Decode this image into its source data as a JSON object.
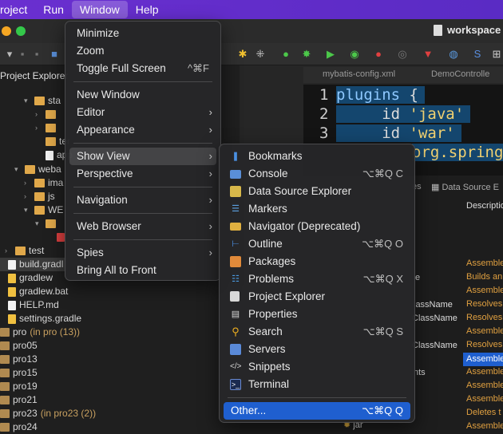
{
  "menubar": {
    "items": [
      "roject",
      "Run",
      "Window",
      "Help"
    ]
  },
  "window": {
    "title": "workspace"
  },
  "explorer": {
    "title": "Project Explorer",
    "rows": [
      "sta",
      "ter",
      "app",
      "weba",
      "ima",
      "js",
      "WE",
      "test",
      "build.gradl",
      "gradlew",
      "gradlew.bat",
      "HELP.md",
      "settings.gradle",
      "pro",
      "pro05",
      "pro13",
      "pro15",
      "pro19",
      "pro21",
      "pro23",
      "pro24"
    ],
    "pro_suffix": "(in pro (13))",
    "pro23_suffix": "(in pro23 (2))"
  },
  "editor": {
    "tabs": [
      "mybatis-config.xml",
      "DemoControlle"
    ],
    "line_numbers": [
      "1",
      "2",
      "3"
    ],
    "lines": [
      {
        "a": "plugins ",
        "b": "{"
      },
      {
        "a": "     id ",
        "b": "'java'"
      },
      {
        "a": "     id ",
        "b": "'war'"
      },
      {
        "a": "",
        "b": "org.spring"
      }
    ]
  },
  "view": {
    "headers": [
      "es",
      "Data Source E",
      "Descriptio"
    ],
    "left_texts": [
      "e",
      "lassName",
      "ClassName",
      "ClassName",
      "nts"
    ],
    "desc_rows": [
      "Assemble",
      "Builds an",
      "Assemble",
      "Resolves",
      "Resolves",
      "Assemble",
      "Resolves",
      "Assemble",
      "Assemble",
      "Assemble",
      "Assemble",
      "Deletes t",
      "Assemble"
    ],
    "last_item": "jar"
  },
  "window_menu": {
    "items": [
      {
        "label": "Minimize"
      },
      {
        "label": "Zoom"
      },
      {
        "label": "Toggle Full Screen",
        "shortcut": "^⌘F"
      },
      {
        "label": "New Window"
      },
      {
        "label": "Editor",
        "chevron": "›"
      },
      {
        "label": "Appearance",
        "chevron": "›"
      },
      {
        "label": "Show View",
        "chevron": "›"
      },
      {
        "label": "Perspective",
        "chevron": "›"
      },
      {
        "label": "Navigation",
        "chevron": "›"
      },
      {
        "label": "Web Browser",
        "chevron": "›"
      },
      {
        "label": "Spies",
        "chevron": "›"
      },
      {
        "label": "Bring All to Front"
      }
    ]
  },
  "show_view_menu": {
    "items": [
      {
        "label": "Bookmarks",
        "shortcut": "",
        "icon": "bookmark-icon",
        "color": "#4a90e2"
      },
      {
        "label": "Console",
        "shortcut": "⌥⌘Q C",
        "icon": "console-icon",
        "color": "#5a8fd8"
      },
      {
        "label": "Data Source Explorer",
        "shortcut": "",
        "icon": "data-source-icon",
        "color": "#d8b84a"
      },
      {
        "label": "Markers",
        "shortcut": "",
        "icon": "markers-icon",
        "color": "#5aa0e0"
      },
      {
        "label": "Navigator (Deprecated)",
        "shortcut": "",
        "icon": "navigator-icon",
        "color": "#e0b040"
      },
      {
        "label": "Outline",
        "shortcut": "⌥⌘Q O",
        "icon": "outline-icon",
        "color": "#4a8ee0"
      },
      {
        "label": "Packages",
        "shortcut": "",
        "icon": "packages-icon",
        "color": "#e08a3a"
      },
      {
        "label": "Problems",
        "shortcut": "⌥⌘Q X",
        "icon": "problems-icon",
        "color": "#4a9ae0"
      },
      {
        "label": "Project Explorer",
        "shortcut": "",
        "icon": "project-explorer-icon",
        "color": "#d8d8d8"
      },
      {
        "label": "Properties",
        "shortcut": "",
        "icon": "properties-icon",
        "color": "#d8d8d8"
      },
      {
        "label": "Search",
        "shortcut": "⌥⌘Q S",
        "icon": "search-icon",
        "color": "#f0b020"
      },
      {
        "label": "Servers",
        "shortcut": "",
        "icon": "servers-icon",
        "color": "#5a8ad8"
      },
      {
        "label": "Snippets",
        "shortcut": "",
        "icon": "snippets-icon",
        "color": "#d8d8d8"
      },
      {
        "label": "Terminal",
        "shortcut": "",
        "icon": "terminal-icon",
        "color": "#3a5aa0"
      },
      {
        "label": "Other...",
        "shortcut": "⌥⌘Q Q",
        "icon": "",
        "color": ""
      }
    ]
  },
  "colors": {
    "accent": "#1f5fcf",
    "menubar": "#6a2fd0"
  }
}
